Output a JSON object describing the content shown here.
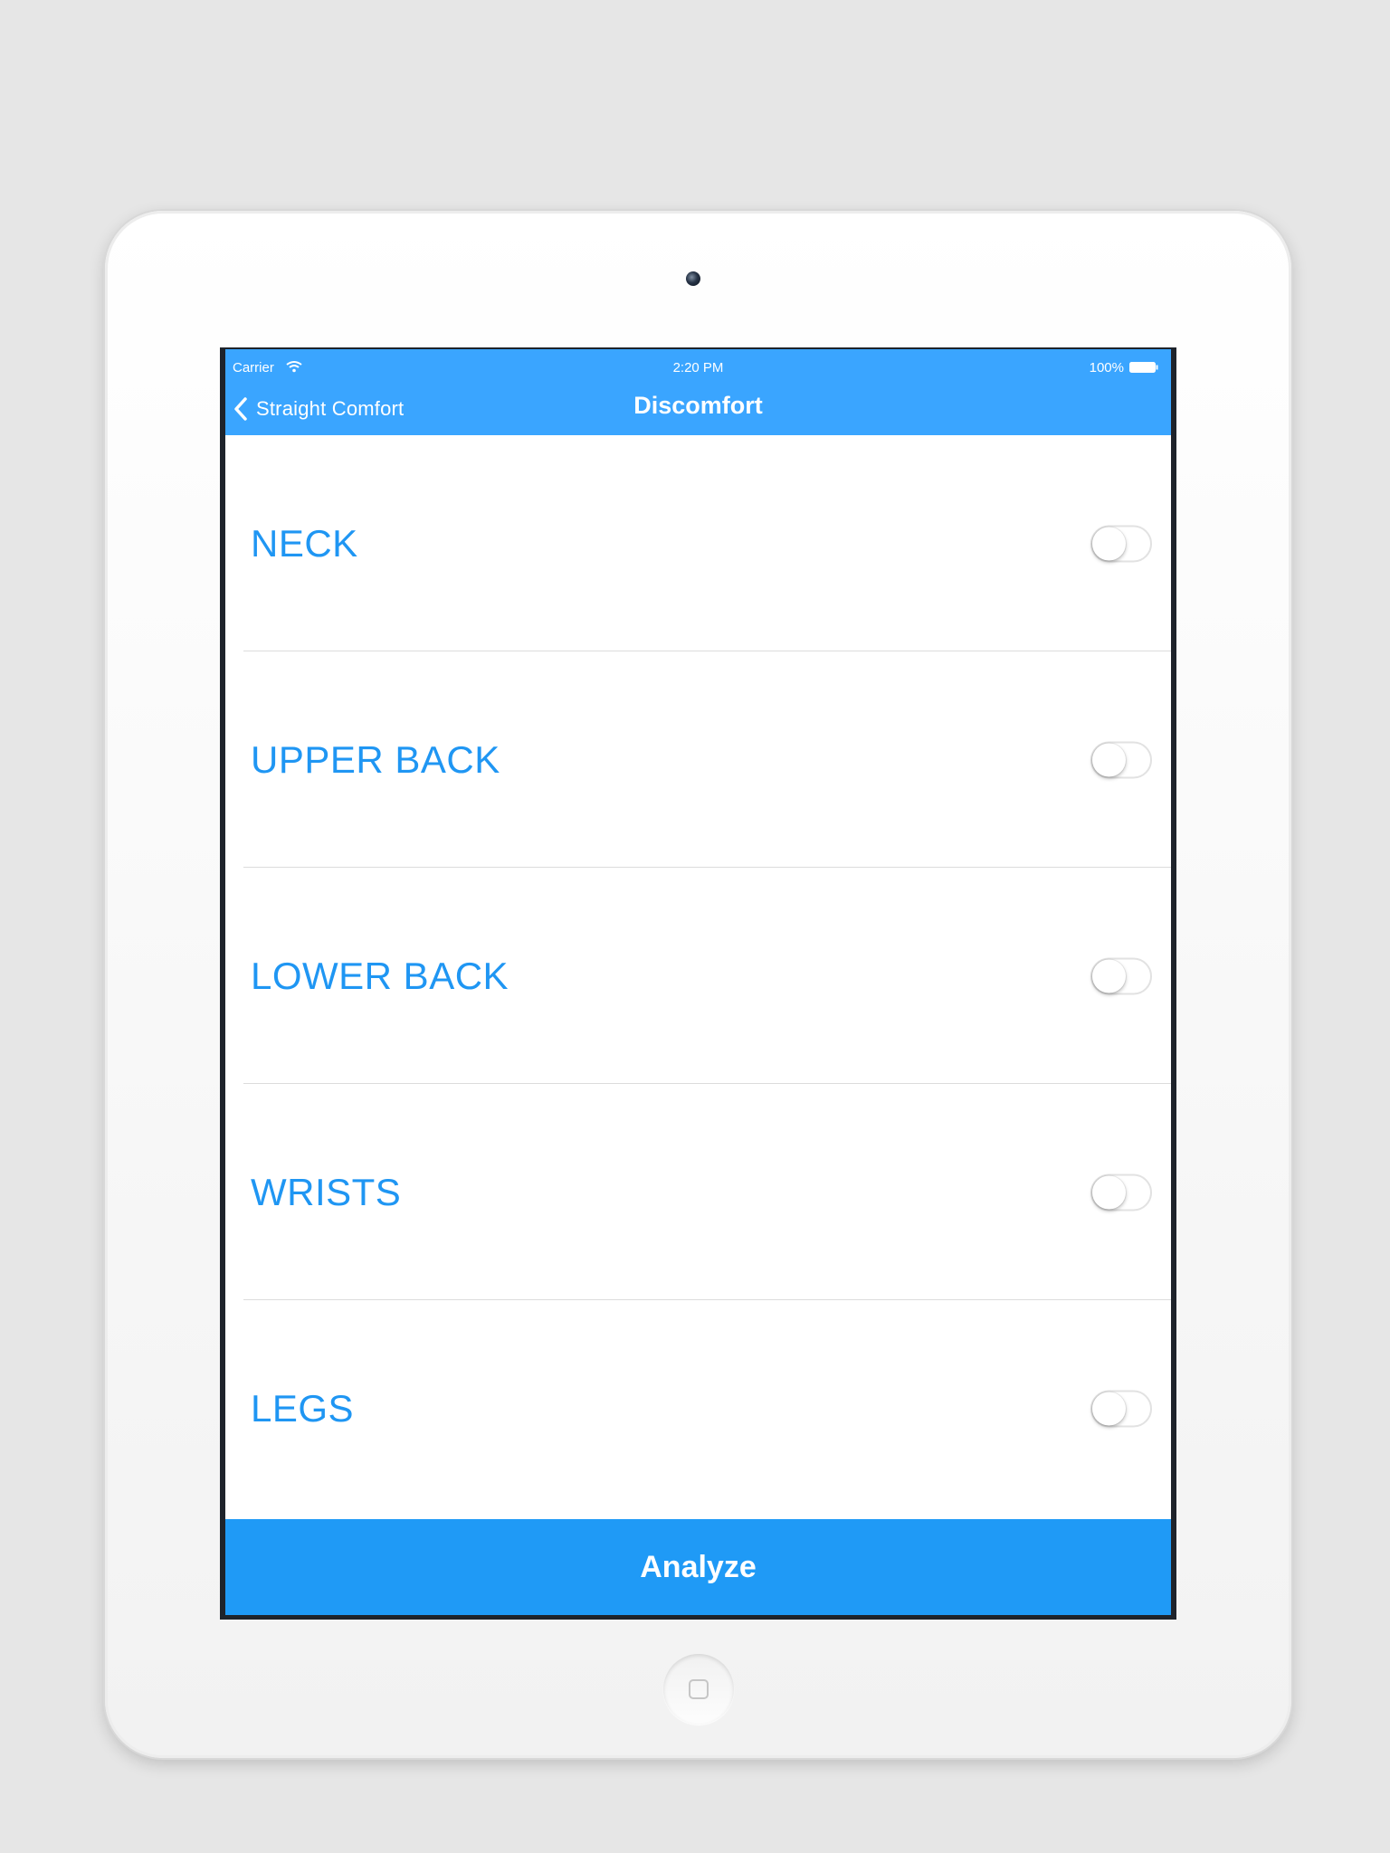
{
  "status_bar": {
    "carrier": "Carrier",
    "time": "2:20 PM",
    "battery": "100%"
  },
  "nav": {
    "back_label": "Straight Comfort",
    "title": "Discomfort"
  },
  "rows": [
    {
      "label": "NECK",
      "enabled": false
    },
    {
      "label": "UPPER BACK",
      "enabled": false
    },
    {
      "label": "LOWER BACK",
      "enabled": false
    },
    {
      "label": "WRISTS",
      "enabled": false
    },
    {
      "label": "LEGS",
      "enabled": false
    }
  ],
  "actions": {
    "analyze_label": "Analyze"
  },
  "colors": {
    "navbar": "#3aa5ff",
    "label": "#1f96f3",
    "analyze": "#1f9af6"
  }
}
